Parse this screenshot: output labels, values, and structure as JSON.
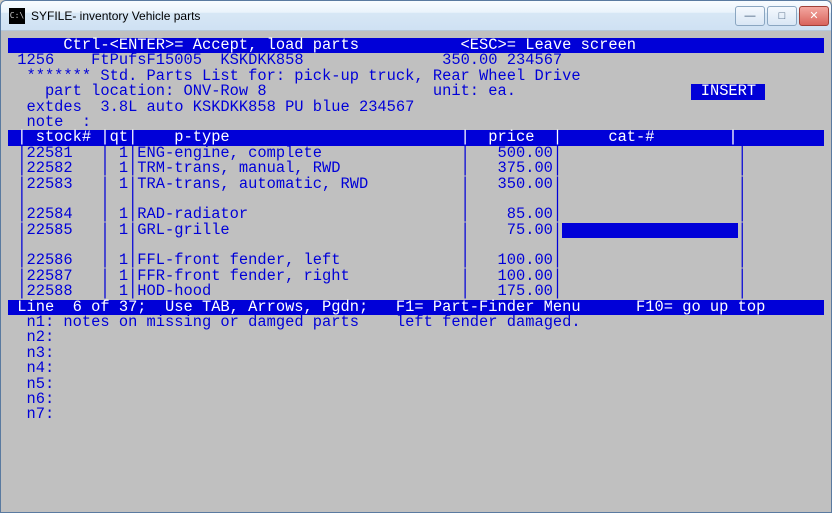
{
  "window": {
    "title": "SYFILE- inventory Vehicle parts"
  },
  "topbar": {
    "left": "      Ctrl-<ENTER>= Accept, load parts",
    "right": "<ESC>= Leave screen     "
  },
  "hdr1": {
    "col1": " 1256",
    "col2": "FtPufsF15005  KSKDKK858",
    "col3": "350.00 234567"
  },
  "hdr2": "  ******* Std. Parts List for: pick-up truck, Rear Wheel Drive",
  "hdr3_left": "    part location: ONV-Row 8",
  "hdr3_unitlabel": "unit:",
  "hdr3_unit": "ea.",
  "insert": " INSERT ",
  "extdes": "  extdes  3.8L auto KSKDKK858 PU blue 234567",
  "note": "  note  :",
  "cols": {
    "stock": " | stock# ",
    "qt": "|qt|",
    "ptype": "    p-type                         ",
    "price": "|  price  ",
    "cat": "|     cat-#        | "
  },
  "rows": [
    {
      "stock": "22581",
      "qt": "1",
      "ptype": "ENG-engine, complete",
      "price": "500.00",
      "blank": false,
      "sel": false
    },
    {
      "stock": "22582",
      "qt": "1",
      "ptype": "TRM-trans, manual, RWD",
      "price": "375.00",
      "blank": false,
      "sel": false
    },
    {
      "stock": "22583",
      "qt": "1",
      "ptype": "TRA-trans, automatic, RWD",
      "price": "350.00",
      "blank": false,
      "sel": false
    },
    {
      "blank": true
    },
    {
      "stock": "22584",
      "qt": "1",
      "ptype": "RAD-radiator",
      "price": "85.00",
      "blank": false,
      "sel": false
    },
    {
      "stock": "22585",
      "qt": "1",
      "ptype": "GRL-grille",
      "price": "75.00",
      "blank": false,
      "sel": true
    },
    {
      "blank": true
    },
    {
      "stock": "22586",
      "qt": "1",
      "ptype": "FFL-front fender, left",
      "price": "100.00",
      "blank": false,
      "sel": false
    },
    {
      "stock": "22587",
      "qt": "1",
      "ptype": "FFR-front fender, right",
      "price": "100.00",
      "blank": false,
      "sel": false
    },
    {
      "stock": "22588",
      "qt": "1",
      "ptype": "HOD-hood",
      "price": "175.00",
      "blank": false,
      "sel": false
    }
  ],
  "status": " Line  6 of 37;  Use TAB, Arrows, Pgdn;   F1= Part-Finder Menu      F10= go up top ",
  "notes": {
    "n1_label": "  n1:",
    "n1_left": " notes on missing or damged parts",
    "n1_right": "left fender damaged.",
    "n2": "  n2:",
    "n3": "  n3:",
    "n4": "  n4:",
    "n5": "  n5:",
    "n6": "  n6:",
    "n7": "  n7:"
  }
}
